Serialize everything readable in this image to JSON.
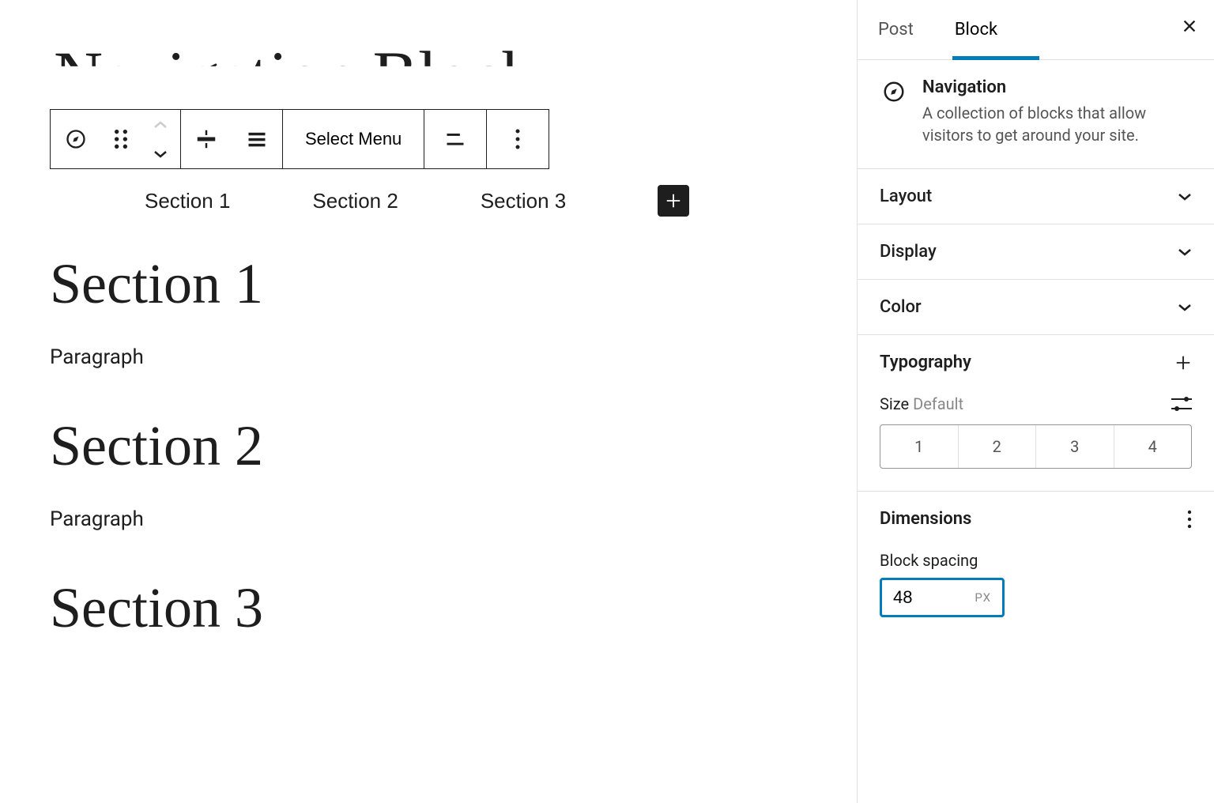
{
  "editor": {
    "page_title": "Navigation Block",
    "toolbar": {
      "block_type_icon": "navigation-icon",
      "select_menu_label": "Select Menu"
    },
    "nav_items": [
      "Section 1",
      "Section 2",
      "Section 3"
    ],
    "sections": [
      {
        "heading": "Section 1",
        "body": "Paragraph"
      },
      {
        "heading": "Section 2",
        "body": "Paragraph"
      },
      {
        "heading": "Section 3",
        "body": "Paragraph"
      }
    ]
  },
  "sidebar": {
    "tabs": {
      "post": "Post",
      "block": "Block",
      "active": "block"
    },
    "block": {
      "name": "Navigation",
      "description": "A collection of blocks that allow visitors to get around your site."
    },
    "panels": {
      "layout": "Layout",
      "display": "Display",
      "color": "Color"
    },
    "typography": {
      "title": "Typography",
      "size_label": "Size",
      "size_secondary": "Default",
      "size_options": [
        "1",
        "2",
        "3",
        "4"
      ]
    },
    "dimensions": {
      "title": "Dimensions",
      "spacing_label": "Block spacing",
      "spacing_value": "48",
      "spacing_unit": "PX"
    },
    "colors": {
      "accent": "#007cba"
    }
  }
}
